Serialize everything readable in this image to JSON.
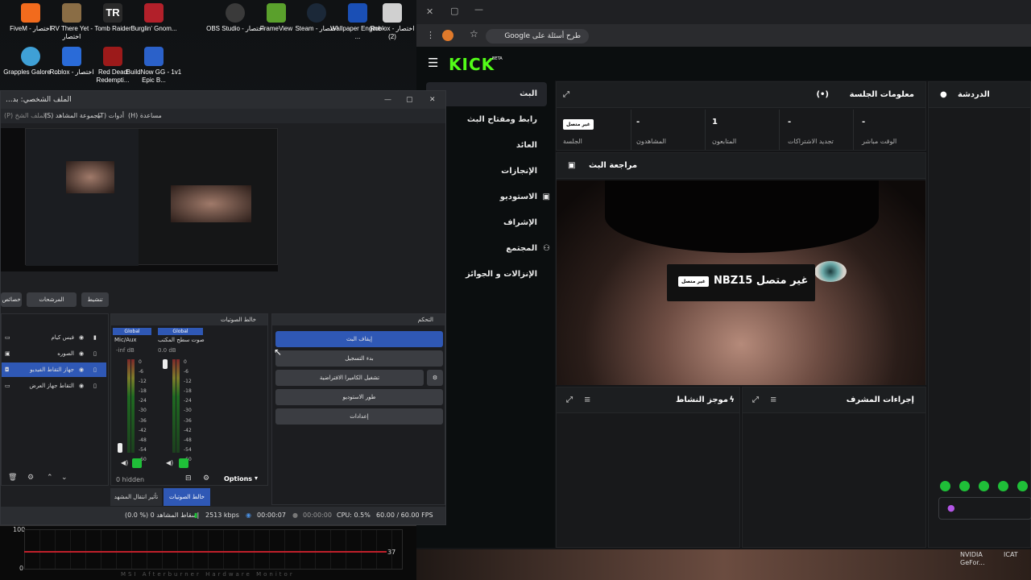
{
  "desktop": {
    "icons": [
      {
        "label": "FiveM - اختصار",
        "color": "#f26b1d"
      },
      {
        "label": "RV There Yet - اختصار",
        "color": "#8a6d45"
      },
      {
        "label": "Tomb Raider",
        "color": "#2a2a2a"
      },
      {
        "label": "Burglin' Gnom...",
        "color": "#b2202a"
      },
      {
        "label": "OBS Studio - اختصار",
        "color": "#3a3a3a"
      },
      {
        "label": "FrameView",
        "color": "#5aa02c"
      },
      {
        "label": "Steam - اختصار",
        "color": "#1b2838"
      },
      {
        "label": "Wallpaper Engine - ...",
        "color": "#1a4fb5"
      },
      {
        "label": "Roblox - اختصار (2)",
        "color": "#d0d0d0"
      },
      {
        "label": "Grapples Galore ...",
        "color": "#3fa0d6"
      },
      {
        "label": "Roblox - اختصار",
        "color": "#2a6bd8"
      },
      {
        "label": "Red Dead Redempti...",
        "color": "#9c1a1a"
      },
      {
        "label": "BuildNow GG - 1v1 Epic B...",
        "color": "#2b61c9"
      }
    ]
  },
  "browser": {
    "search_pill": "طرح أسئلة على Google",
    "kick": {
      "logo": "KICK",
      "beta": "BETA",
      "sidebar": [
        "البث",
        "رابط ومفتاح البث",
        "العائد",
        "الإنجازات",
        "الاستوديو",
        "الإشراف",
        "المجتمع",
        "الإنزالات و الجوائز"
      ],
      "session_info": {
        "title": "معلومات الجلسة",
        "offline_badge": "غير متصل",
        "session_label": "الجلسة",
        "viewers_value": "-",
        "viewers_label": "المشاهدون",
        "followers_value": "1",
        "followers_label": "المتابعون",
        "renewals_value": "-",
        "renewals_label": "تجديد الاشتراكات",
        "live_time_value": "-",
        "live_time_label": "الوقت مباشر"
      },
      "stream_preview": {
        "title": "مراجعة البث",
        "overlay_text": "غير متصل NBZ15",
        "overlay_badge": "غير متصل"
      },
      "activity_title": "موجز النشاط",
      "mod_actions_title": "إجراءات المشرف",
      "chat_title": "الدردشة"
    }
  },
  "obs": {
    "window_title": "الملف الشخصي: بد...",
    "menu": [
      "(P) الملف الشخ...",
      "(S) مجموعة المشاهد",
      "(T) أدوات",
      "(H) مساعدة"
    ],
    "scene_buttons": [
      "تنشيط",
      "المرشحات",
      "خصائص"
    ],
    "sources": [
      {
        "name": "فيس كيام",
        "icon": "folder-icon"
      },
      {
        "name": "الصوره",
        "icon": "image-icon"
      },
      {
        "name": "جهاز التقاط الفيديو",
        "icon": "camera-icon",
        "selected": true
      },
      {
        "name": "التقاط جهاز العرض",
        "icon": "monitor-icon"
      }
    ],
    "mixer": {
      "title": "خالط الصوتيات",
      "ch1": {
        "tag": "Global",
        "name": "Mic/Aux",
        "level": "-inf dB"
      },
      "ch2": {
        "tag": "Global",
        "name": "صوت سطح المكتب",
        "level": "0.0 dB"
      },
      "scale": [
        "0",
        "-6",
        "-12",
        "-18",
        "-24",
        "-30",
        "-36",
        "-42",
        "-48",
        "-54",
        "-60"
      ],
      "hidden": "0 hidden",
      "options": "Options"
    },
    "controls": {
      "title": "التحكم",
      "stop_stream": "إيقاف البث",
      "start_record": "بدء التسجيل",
      "virtual_cam": "تشغيل الكاميرا الافتراضية",
      "studio_mode": "طور الاستوديو",
      "settings": "إعدادات"
    },
    "tabs": [
      "تأثير انتقال المشهد",
      "خالط الصوتيات"
    ],
    "status": {
      "dropped": "(0.0 %) إسقاط المشاهد 0",
      "bitrate": "2513 kbps",
      "stream_time": "00:00:07",
      "rec_time": "00:00:00",
      "cpu": "CPU: 0.5%",
      "fps": "60.00 / 60.00 FPS"
    }
  },
  "afterburner": {
    "y_top": "100",
    "y_bottom": "0",
    "readout": "37",
    "caption": "MSI Afterburner Hardware Monitor"
  },
  "tray": {
    "nvidia": "NVIDIA GeFor...",
    "icat": "ICAT"
  }
}
